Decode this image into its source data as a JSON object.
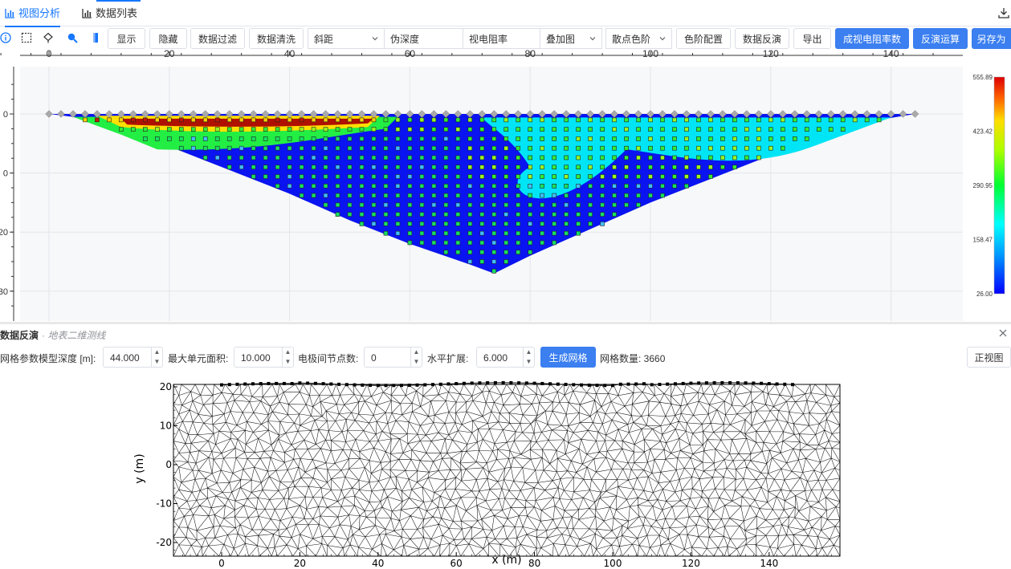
{
  "tabs": [
    {
      "label": "视图分析",
      "active": true
    },
    {
      "label": "数据列表",
      "active": false
    }
  ],
  "toolbar": {
    "show": "显示",
    "hide": "隐藏",
    "filter": "数据过滤",
    "clean": "数据清洗",
    "select_x": "斜距",
    "select_y": "伪深度",
    "select_z": "视电阻率",
    "select_overlay": "叠加图",
    "select_scatter": "散点色阶",
    "color_config": "色阶配置",
    "data_inversion": "数据反演",
    "export": "导出",
    "gen_resistivity": "成视电阻率数",
    "inversion_run": "反演运算",
    "save_as": "另存为"
  },
  "colors": {
    "accent": "#3b7ff0",
    "bg_plot": "#f7f8fa",
    "grid": "#e2e5ea"
  },
  "chart_data": [
    {
      "type": "heatmap",
      "x_ticks": [
        "0",
        "20",
        "40",
        "60",
        "80",
        "100",
        "120",
        "140"
      ],
      "x_tick_values": [
        0,
        20,
        40,
        60,
        80,
        100,
        120,
        140
      ],
      "y_ticks": [
        "0",
        "0",
        "20",
        "30"
      ],
      "y_tick_values": [
        0,
        10,
        20,
        30
      ],
      "xlim": [
        -8,
        150
      ],
      "ylim": [
        -7,
        34
      ],
      "colorbar": {
        "labels": [
          "555.89",
          "423.42",
          "290.95",
          "158.47",
          "26.00"
        ],
        "min": 26.0,
        "max": 555.89
      },
      "electrode_range": [
        0,
        144
      ],
      "electrode_spacing": 2,
      "depth_profile": {
        "x": [
          0,
          4,
          8,
          12,
          20,
          30,
          40,
          50,
          60,
          70,
          74,
          80,
          90,
          100,
          110,
          120,
          130,
          138,
          144
        ],
        "y": [
          0,
          0.5,
          1.5,
          3,
          5.5,
          9.5,
          13.5,
          18,
          22,
          25.5,
          27,
          24,
          19.5,
          15,
          11,
          7,
          3.5,
          1,
          0
        ]
      }
    },
    {
      "type": "mesh",
      "xlabel": "x (m)",
      "ylabel": "y (m)",
      "x_ticks": [
        "0",
        "20",
        "40",
        "60",
        "80",
        "100",
        "120",
        "140"
      ],
      "x_tick_values": [
        0,
        20,
        40,
        60,
        80,
        100,
        120,
        140
      ],
      "y_ticks": [
        "20",
        "10",
        "0",
        "-10",
        "-20"
      ],
      "y_tick_values": [
        20,
        10,
        0,
        -10,
        -20
      ],
      "xlim": [
        -12,
        158
      ],
      "ylim": [
        -23,
        21
      ],
      "electrode_range": [
        0,
        146
      ],
      "electrode_spacing": 2
    }
  ],
  "inversion": {
    "title": "数据反演",
    "subtitle": "· 地表二维测线",
    "grid_params": "网格参数",
    "model_depth_label": "模型深度 [m]:",
    "model_depth": "44.000",
    "max_area_label": "最大单元面积:",
    "max_area": "10.000",
    "nodes_label": "电极间节点数:",
    "nodes": "0",
    "horiz_label": "水平扩展:",
    "horiz": "6.000",
    "generate": "生成网格",
    "grid_count": "网格数量: 3660",
    "front_view": "正视图"
  }
}
